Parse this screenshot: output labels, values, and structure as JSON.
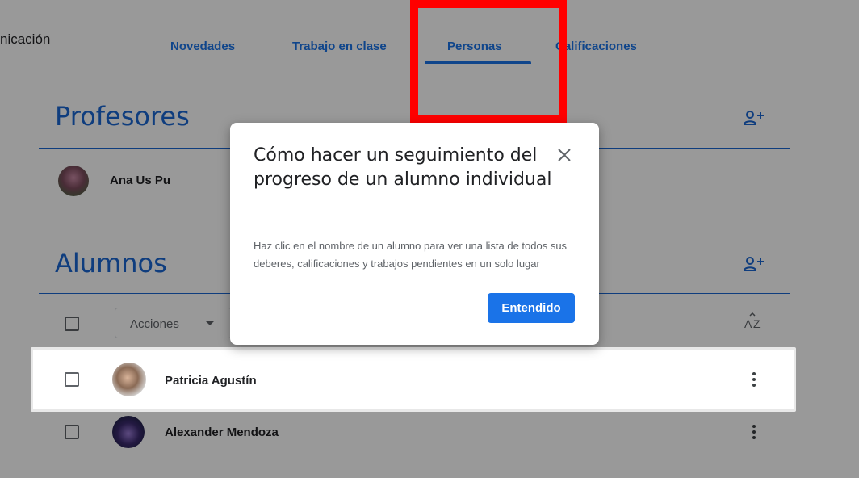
{
  "header": {
    "class_name": "nicación",
    "tabs": [
      {
        "label": "Novedades"
      },
      {
        "label": "Trabajo en clase"
      },
      {
        "label": "Personas"
      },
      {
        "label": "Calificaciones"
      }
    ],
    "active_tab": "Personas"
  },
  "teachers": {
    "title": "Profesores",
    "add_icon": "add-person-icon",
    "items": [
      {
        "name": "Ana Us Pu"
      }
    ]
  },
  "students": {
    "title": "Alumnos",
    "add_icon": "add-person-icon",
    "actions_label": "Acciones",
    "sort_icon": "sort-az-icon",
    "items": [
      {
        "name": "Patricia Agustín"
      },
      {
        "name": "Alexander Mendoza"
      }
    ]
  },
  "dialog": {
    "title": "Cómo hacer un seguimiento del progreso de un alumno individual",
    "body": "Haz clic en el nombre de un alumno para ver una lista de todos sus deberes, calificaciones y trabajos pendientes en un solo lugar",
    "ok_label": "Entendido",
    "close_icon": "close-icon"
  },
  "colors": {
    "accent": "#1a73e8",
    "title_blue": "#1967d2",
    "highlight_red": "#ff0000"
  }
}
